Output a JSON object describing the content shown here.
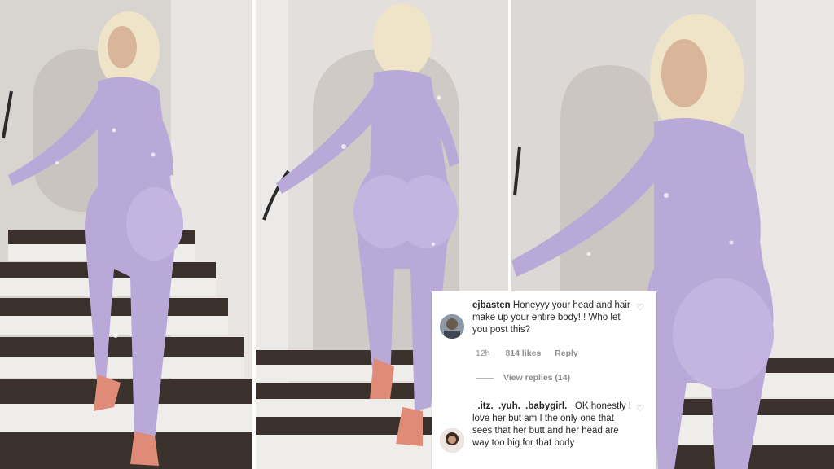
{
  "comments": [
    {
      "username": "ejbasten",
      "text": "Honeyyy your head and hair make up your entire body!!! Who let you post this?",
      "time": "12h",
      "likes": "814 likes",
      "reply_label": "Reply",
      "view_replies": "View replies (14)"
    },
    {
      "username": "_.itz._.yuh._.babygirl._",
      "text": "OK honestly I love her but am I the only one that sees that her butt and her head are way too big for that body"
    }
  ],
  "colors": {
    "suit": "#b9a9d8",
    "hair": "#efe3c8",
    "stair_tread": "#3a302b",
    "stair_riser": "#f1efec",
    "wall": "#d6d2ce",
    "card_bg": "#ffffff",
    "meta_text": "#8e8e8e"
  },
  "icons": [
    "heart-outline-icon",
    "heart-outline-icon"
  ]
}
